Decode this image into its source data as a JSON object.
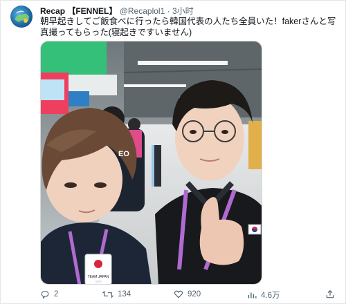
{
  "tweet": {
    "author_name": "Recap 【FENNEL】",
    "handle": "@Recaplol1",
    "separator": "·",
    "time": "3小时",
    "text": "朝早起きしてご飯食べに行ったら韓国代表の人たち全員いた！fakerさんと写真撮ってもらった(寝起きですいません)",
    "photo": {
      "jersey_text": "EO",
      "badge_text": "TEAM JAPAN"
    }
  },
  "actions": {
    "reply_count": "2",
    "retweet_count": "134",
    "like_count": "920",
    "view_count": "4.6万"
  },
  "colors": {
    "text": "#0f1419",
    "secondary": "#536471",
    "lanyard_purple": "#b06ad0"
  }
}
